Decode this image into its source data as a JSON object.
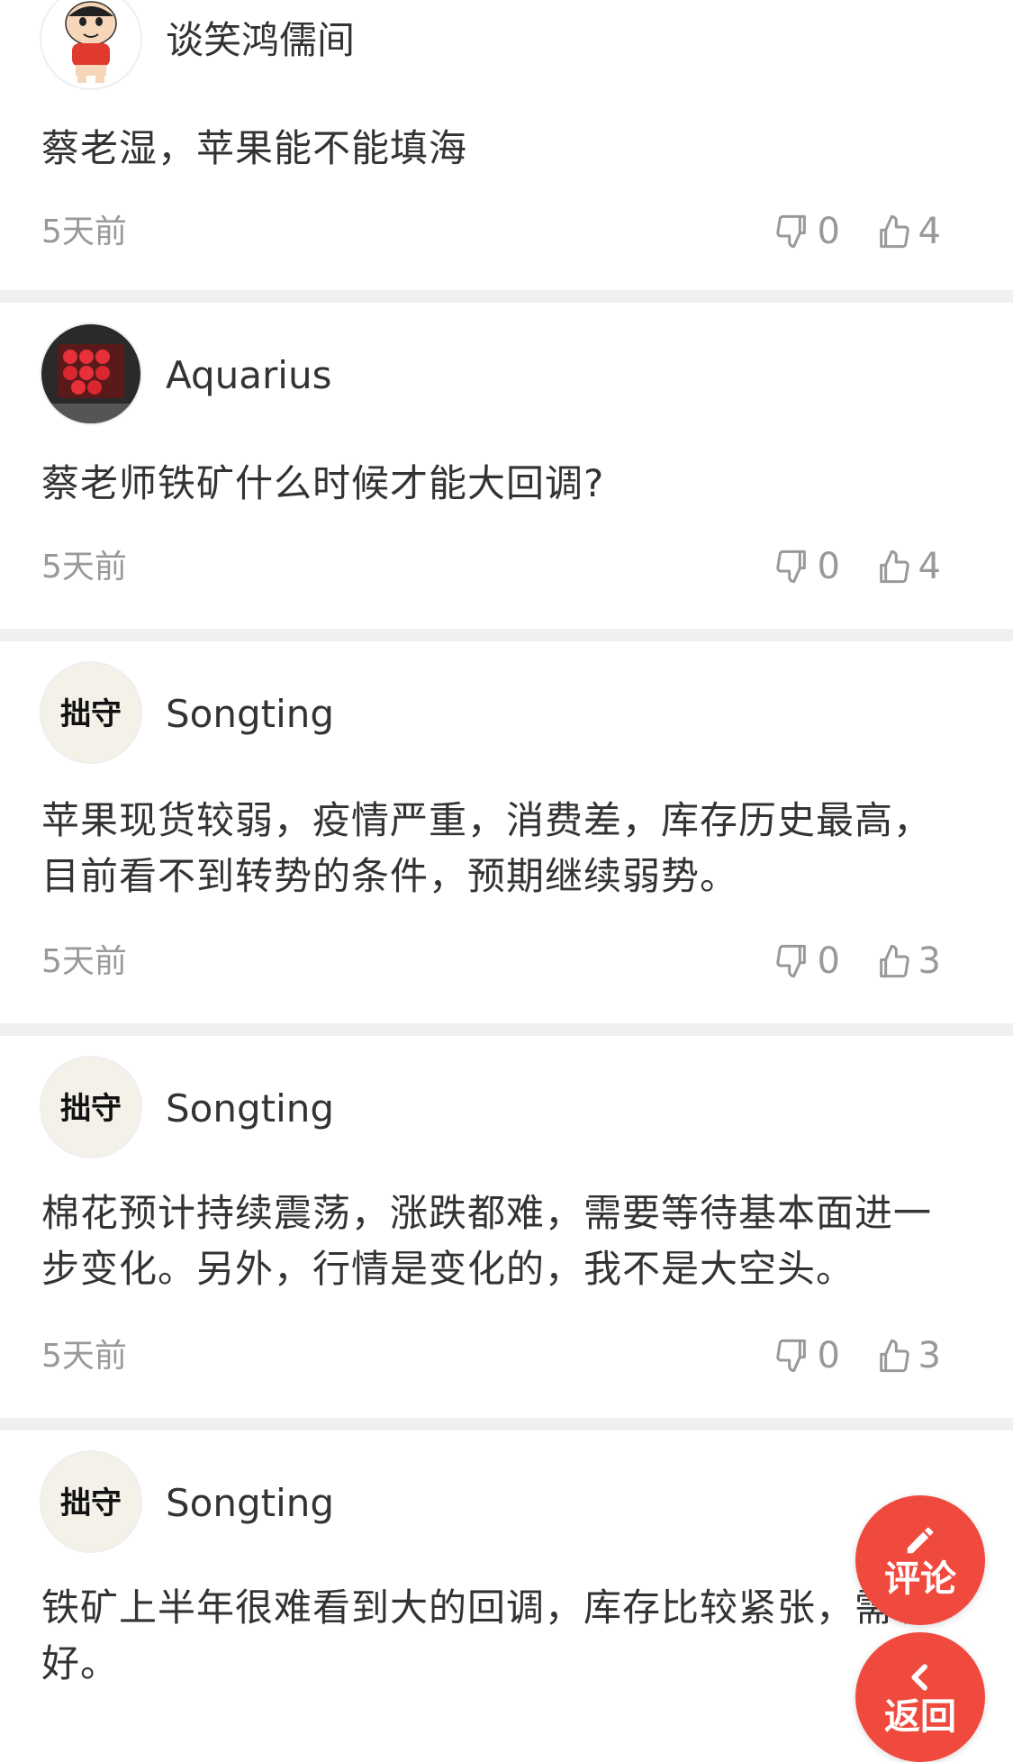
{
  "accent_color": "#f04a3e",
  "comments": [
    {
      "username": "谈笑鸿儒间",
      "avatar_icon": "cartoon-boy-avatar",
      "text": "蔡老湿，苹果能不能填海",
      "time": "5天前",
      "downvotes": "0",
      "upvotes": "4"
    },
    {
      "username": "Aquarius",
      "avatar_icon": "red-fruit-box-avatar",
      "text": "蔡老师铁矿什么时候才能大回调?",
      "time": "5天前",
      "downvotes": "0",
      "upvotes": "4"
    },
    {
      "username": "Songting",
      "avatar_icon": "calligraphy-avatar",
      "avatar_text": "拙守",
      "text": "苹果现货较弱，疫情严重，消费差，库存历史最高，目前看不到转势的条件，预期继续弱势。",
      "time": "5天前",
      "downvotes": "0",
      "upvotes": "3"
    },
    {
      "username": "Songting",
      "avatar_icon": "calligraphy-avatar",
      "avatar_text": "拙守",
      "text": "棉花预计持续震荡，涨跌都难，需要等待基本面进一步变化。另外，行情是变化的，我不是大空头。",
      "time": "5天前",
      "downvotes": "0",
      "upvotes": "3"
    },
    {
      "username": "Songting",
      "avatar_icon": "calligraphy-avatar",
      "avatar_text": "拙守",
      "text": "铁矿上半年很难看到大的回调，库存比较紧张，需求好。"
    }
  ],
  "fab": {
    "comment_label": "评论",
    "comment_icon": "pencil-icon",
    "back_label": "返回",
    "back_icon": "chevron-left-icon"
  }
}
